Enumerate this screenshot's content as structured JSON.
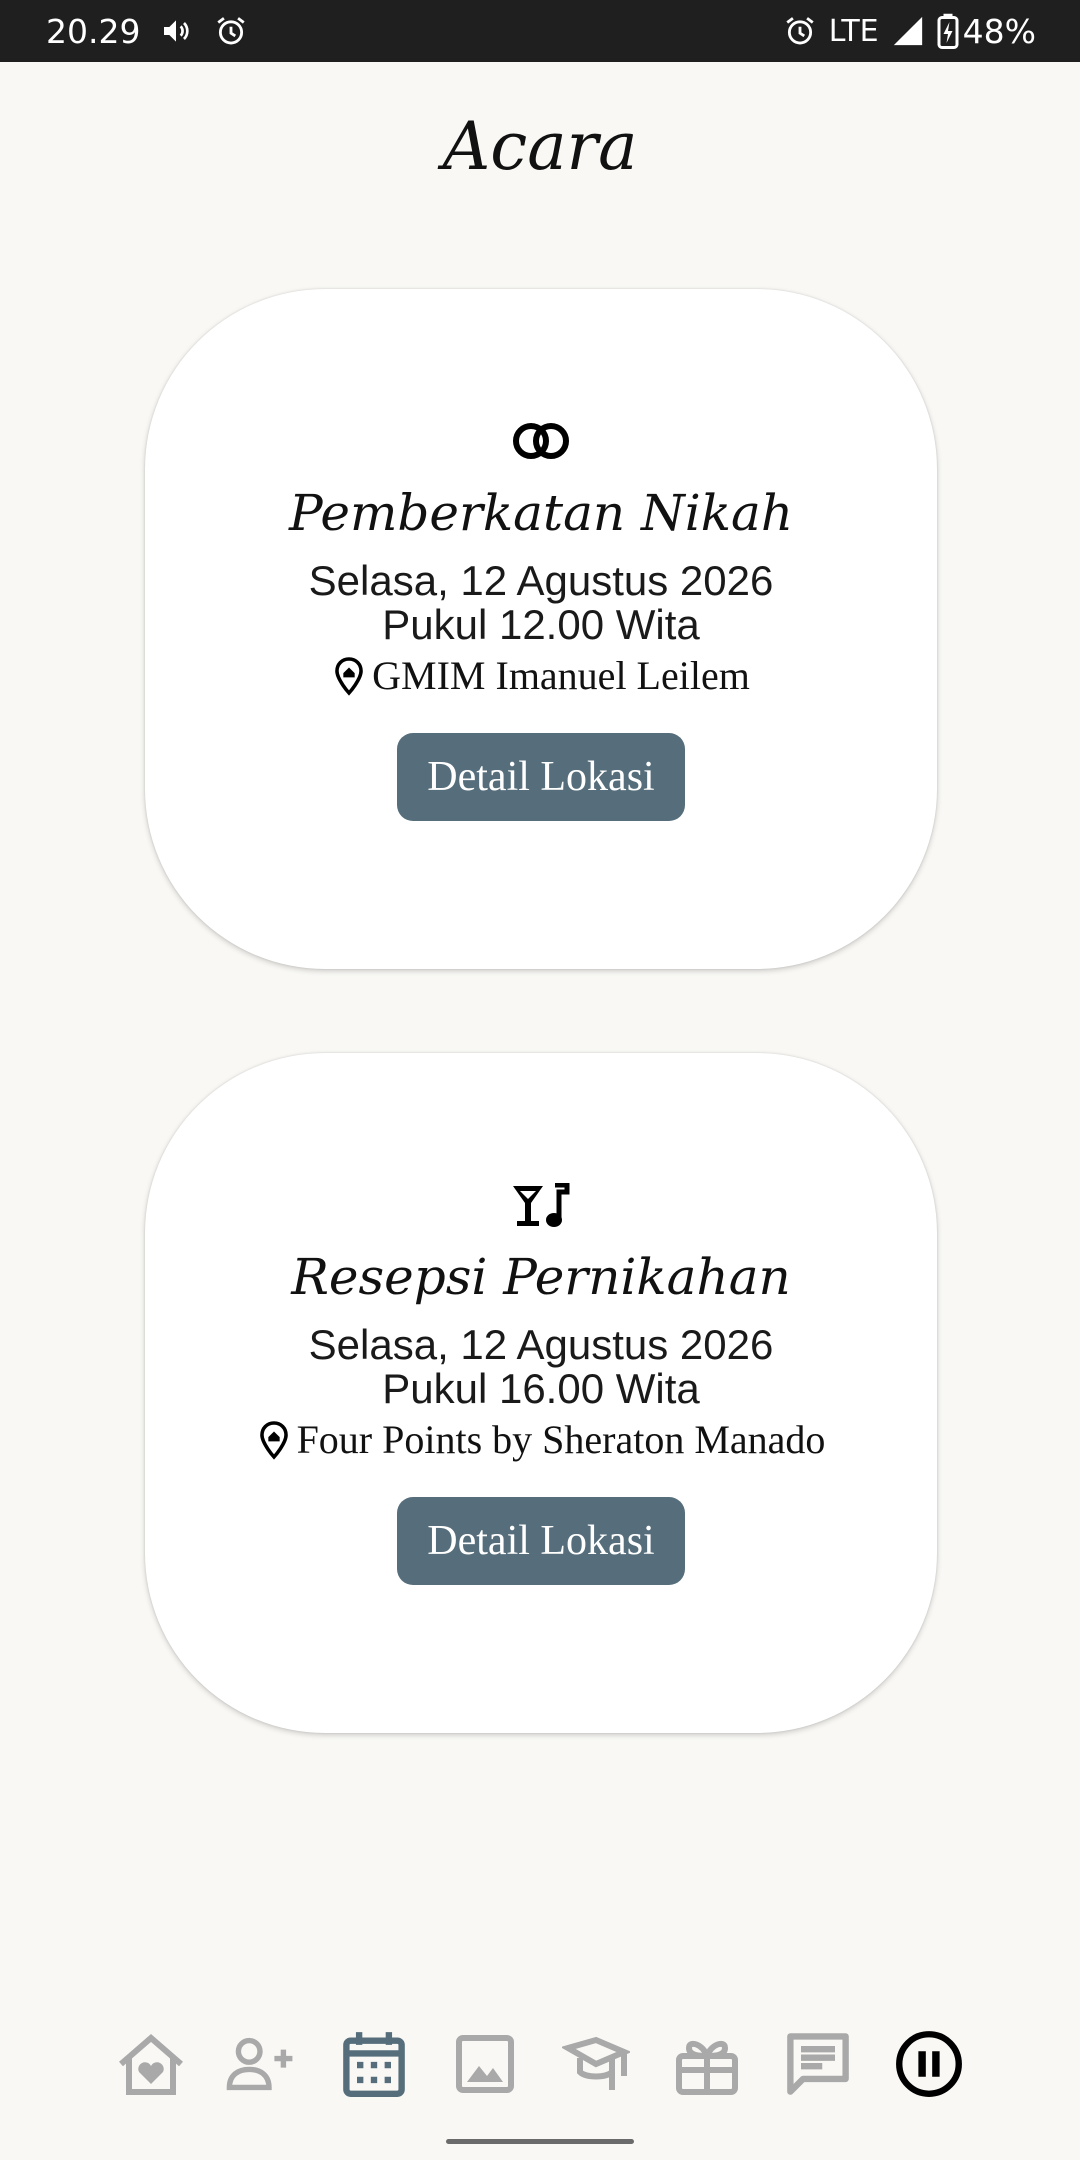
{
  "status_bar": {
    "time": "20.29",
    "network": "LTE",
    "battery": "48%",
    "icons": [
      "volume-icon",
      "alarm-icon",
      "alarm-icon",
      "signal-icon",
      "battery-charging-icon"
    ]
  },
  "page": {
    "title": "Acara"
  },
  "events": [
    {
      "icon": "wedding-rings-icon",
      "title": "Pemberkatan Nikah",
      "date": "Selasa, 12 Agustus 2026",
      "time": "Pukul 12.00 Wita",
      "location": "GMIM Imanuel Leilem",
      "button_label": "Detail Lokasi"
    },
    {
      "icon": "cocktail-music-icon",
      "title": "Resepsi Pernikahan",
      "date": "Selasa, 12 Agustus 2026",
      "time": "Pukul 16.00 Wita",
      "location": "Four Points by Sheraton Manado",
      "button_label": "Detail Lokasi"
    }
  ],
  "bottom_nav": {
    "items": [
      "home-heart-icon",
      "add-person-icon",
      "calendar-icon",
      "image-icon",
      "graduation-icon",
      "gift-icon",
      "message-icon",
      "pause-icon"
    ],
    "active": "calendar-icon"
  },
  "colors": {
    "background": "#f9f8f5",
    "button": "#566e7b",
    "nav_active": "#566e7b",
    "nav_inactive": "#a9a9a9",
    "statusbar": "#1f1f1f"
  }
}
